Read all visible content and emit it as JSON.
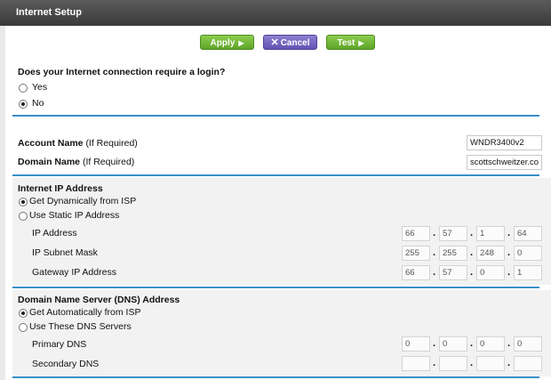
{
  "header": {
    "title": "Internet Setup"
  },
  "toolbar": {
    "apply_label": "Apply",
    "cancel_label": "Cancel",
    "test_label": "Test"
  },
  "login": {
    "question": "Does your Internet connection require a login?",
    "options": [
      "Yes",
      "No"
    ],
    "selected": "No"
  },
  "account": {
    "account_name_label": "Account Name",
    "account_name_hint": "(If Required)",
    "account_name_value": "WNDR3400v2",
    "domain_name_label": "Domain Name",
    "domain_name_hint": "(If Required)",
    "domain_name_value": "scottschweitzer.co"
  },
  "internet_ip": {
    "heading": "Internet IP Address",
    "options": [
      "Get Dynamically from ISP",
      "Use Static IP Address"
    ],
    "selected": "Get Dynamically from ISP",
    "ip_label": "IP Address",
    "ip": [
      "66",
      "57",
      "1",
      "64"
    ],
    "subnet_label": "IP Subnet Mask",
    "subnet": [
      "255",
      "255",
      "248",
      "0"
    ],
    "gateway_label": "Gateway IP Address",
    "gateway": [
      "66",
      "57",
      "0",
      "1"
    ]
  },
  "dns": {
    "heading": "Domain Name Server (DNS) Address",
    "options": [
      "Get Automatically from ISP",
      "Use These DNS Servers"
    ],
    "selected": "Get Automatically from ISP",
    "primary_label": "Primary DNS",
    "primary": [
      "0",
      "0",
      "0",
      "0"
    ],
    "secondary_label": "Secondary DNS",
    "secondary": [
      "",
      "",
      "",
      ""
    ]
  },
  "colors": {
    "accent_rule": "#3a8fc9",
    "button_green": "#6cb335",
    "button_purple": "#6f61c0",
    "title_bar": "#4a4a4a"
  }
}
